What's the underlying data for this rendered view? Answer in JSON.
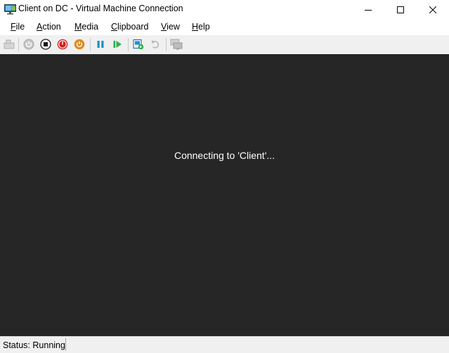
{
  "window": {
    "title": "Client on DC - Virtual Machine Connection",
    "controls": [
      "minimize",
      "maximize",
      "close"
    ]
  },
  "menu": [
    {
      "mnemonic": "F",
      "rest": "ile"
    },
    {
      "mnemonic": "A",
      "rest": "ction"
    },
    {
      "mnemonic": "M",
      "rest": "edia"
    },
    {
      "mnemonic": "C",
      "rest": "lipboard"
    },
    {
      "mnemonic": "V",
      "rest": "iew"
    },
    {
      "mnemonic": "H",
      "rest": "elp"
    }
  ],
  "toolbar": {
    "buttons": [
      {
        "icon": "ctrl-alt-del-icon",
        "enabled": false
      },
      {
        "icon": "start-icon",
        "enabled": false
      },
      {
        "icon": "turn-off-icon",
        "enabled": true
      },
      {
        "icon": "shut-down-icon",
        "enabled": true,
        "color": "#d42020"
      },
      {
        "icon": "save-icon",
        "enabled": true,
        "color": "#e08a1c"
      },
      {
        "icon": "pause-icon",
        "enabled": true,
        "color": "#1a8fc9"
      },
      {
        "icon": "resume-icon",
        "enabled": true,
        "color": "#2bb24c"
      },
      {
        "icon": "checkpoint-icon",
        "enabled": true
      },
      {
        "icon": "revert-icon",
        "enabled": false
      },
      {
        "icon": "enhanced-session-icon",
        "enabled": false
      }
    ]
  },
  "viewport": {
    "message": "Connecting to 'Client'...",
    "background": "#262626"
  },
  "status": {
    "text": "Status: Running"
  }
}
